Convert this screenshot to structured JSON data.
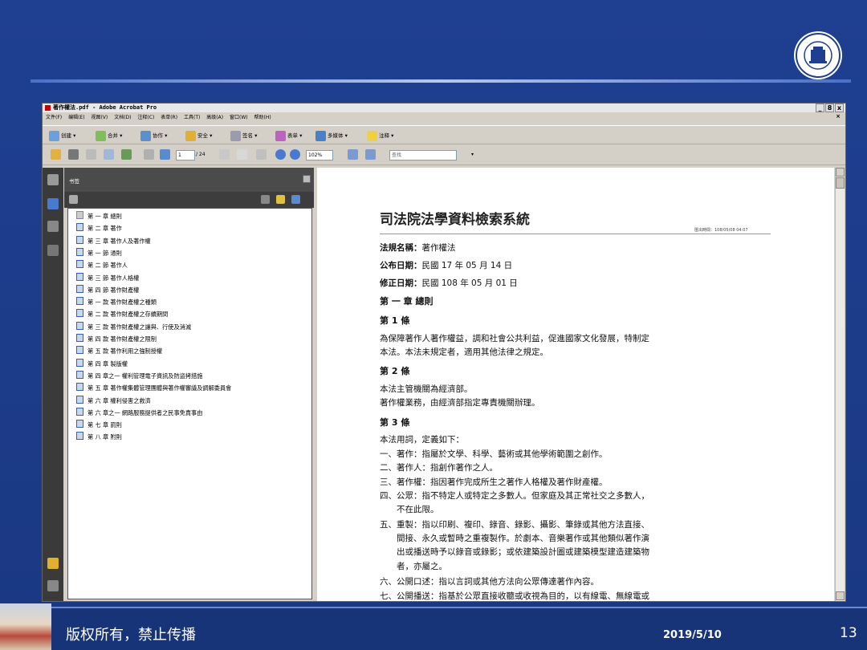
{
  "window": {
    "title": "著作權法.pdf - Adobe Acrobat Pro",
    "controls": [
      "_",
      "8",
      "x"
    ]
  },
  "menu": [
    "文件(F)",
    "编辑(E)",
    "视图(V)",
    "文档(D)",
    "注释(C)",
    "表单(R)",
    "工具(T)",
    "高级(A)",
    "窗口(W)",
    "帮助(H)"
  ],
  "menu_close": "×",
  "toolbar1": {
    "create": "创建 ▾",
    "merge": "合并 ▾",
    "collaborate": "协作 ▾",
    "secure": "安全 ▾",
    "sign": "签名 ▾",
    "forms": "表单 ▾",
    "multimedia": "多媒体 ▾",
    "comment": "注释 ▾"
  },
  "toolbar2": {
    "page_current": "1",
    "page_total": "/ 24",
    "zoom": "102%",
    "search_placeholder": "查找"
  },
  "bookmarks": {
    "header": "书签",
    "items": [
      "第 一 章 總則",
      "第 二 章 著作",
      "第 三 章 著作人及著作權",
      "第 一 節 通則",
      "第 二 節 著作人",
      "第 三 節 著作人格權",
      "第 四 節 著作財產權",
      "第 一 款 著作財產權之種類",
      "第 二 款 著作財產權之存續期間",
      "第 三 款 著作財產權之讓與、行使及消滅",
      "第 四 款 著作財產權之限制",
      "第 五 款 著作利用之強制授權",
      "第 四 章 製版權",
      "第 四 章之一 權利管理電子資訊及防盜拷措施",
      "第 五 章 著作權集體管理團體與著作權審議及調解委員會",
      "第 六 章 權利侵害之救濟",
      "第 六 章之一 網路服務提供者之民事免責事由",
      "第 七 章 罰則",
      "第 八 章 附則"
    ]
  },
  "document": {
    "title": "司法院法學資料檢索系統",
    "export_time": "匯出時間：108/05/08 04:07",
    "law_name_label": "法規名稱：",
    "law_name": "著作權法",
    "promulgated_label": "公布日期：",
    "promulgated": "民國 17 年 05 月 14 日",
    "amended_label": "修正日期：",
    "amended": "民國 108 年 05 月 01 日",
    "chapter1": "第 一 章 總則",
    "art1": "第 1 條",
    "art1_l1": "為保障著作人著作權益，調和社會公共利益，促進國家文化發展，特制定",
    "art1_l2": "本法。本法未規定者，適用其他法律之規定。",
    "art2": "第 2 條",
    "art2_l1": "本法主管機關為經濟部。",
    "art2_l2": "著作權業務，由經濟部指定專責機關辦理。",
    "art3": "第 3 條",
    "art3_intro": "本法用詞，定義如下：",
    "art3_1": "一、著作：指屬於文學、科學、藝術或其他學術範圍之創作。",
    "art3_2": "二、著作人：指創作著作之人。",
    "art3_3": "三、著作權：指因著作完成所生之著作人格權及著作財產權。",
    "art3_4a": "四、公眾：指不特定人或特定之多數人。但家庭及其正常社交之多數人，",
    "art3_4b": "不在此限。",
    "art3_5a": "五、重製：指以印刷、複印、錄音、錄影、攝影、筆錄或其他方法直接、",
    "art3_5b": "間接、永久或暫時之重複製作。於劇本、音樂著作或其他類似著作演",
    "art3_5c": "出或播送時予以錄音或錄影；或依建築設計圖或建築模型建造建築物",
    "art3_5d": "者，亦屬之。",
    "art3_6": "六、公開口述：指以言詞或其他方法向公眾傳達著作內容。",
    "art3_7": "七、公開播送：指基於公眾直接收聽或收視為目的，以有線電、無線電或"
  },
  "footer": {
    "copyright": "版权所有，禁止传播",
    "date": "2019/5/10",
    "page": "13"
  },
  "colors": {
    "slide_bg": "#1c3c8a",
    "footer_bg": "#173478",
    "nav_dark": "#3a3a3a"
  }
}
